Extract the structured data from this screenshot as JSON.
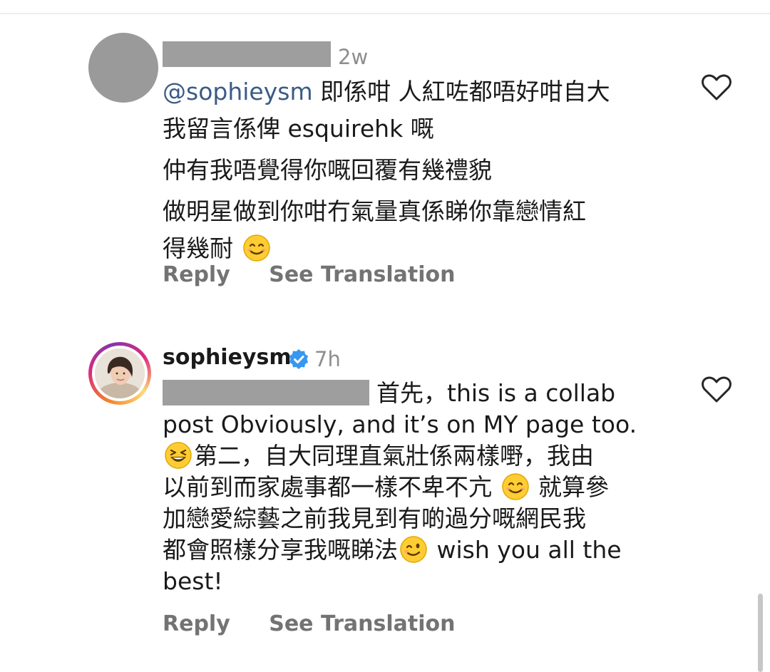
{
  "comments": [
    {
      "username": "",
      "time": "2w",
      "lines": [
        {
          "mention": "@sophieysm",
          "text": " 即係咁 人紅咗都唔好咁自大"
        },
        {
          "mention": "",
          "text": "我留言係俾 esquirehk 嘅"
        },
        {
          "mention": "",
          "text": "仲有我唔覺得你嘅回覆有幾禮貌"
        },
        {
          "mention": "",
          "text": "做明星做到你咁冇氣量真係睇你靠戀情紅"
        },
        {
          "mention": "",
          "text": "得幾耐"
        }
      ],
      "reply_label": "Reply",
      "translate_label": "See Translation",
      "like_icon": "heart-outline-icon"
    },
    {
      "username": "sophieysm",
      "verified": true,
      "time": "7h",
      "lines": [
        "首先，this is a collab",
        "post Obviously, and it’s on MY page too.",
        "第二，自大同理直氣壯係兩樣嘢，我由",
        "以前到而家處事都一樣不卑不亢",
        "就算參",
        "加戀愛綜藝之前我見到有啲過分嘅網民我",
        "都會照樣分享我嘅睇法",
        "wish you all the",
        "best!"
      ],
      "reply_label": "Reply",
      "translate_label": "See Translation",
      "like_icon": "heart-outline-icon"
    }
  ],
  "icons": {
    "smile": "smiling-face-emoji",
    "grin": "grinning-squinting-face-emoji",
    "wink": "winking-face-emoji",
    "verified": "verified-badge-icon"
  },
  "colors": {
    "mention": "#3b5b86",
    "muted": "#8e8e8e",
    "action": "#737373",
    "verified": "#3897f0"
  }
}
